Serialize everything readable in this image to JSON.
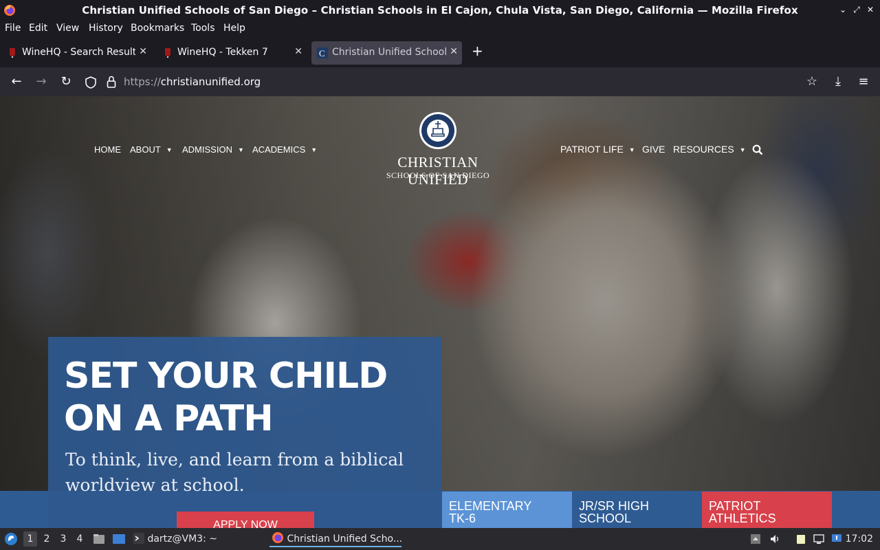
{
  "window": {
    "title": "Christian Unified Schools of San Diego – Christian Schools in El Cajon, Chula Vista, San Diego, California — Mozilla Firefox",
    "controls": [
      "⌄",
      "⤢",
      "✕"
    ]
  },
  "menubar": {
    "items": [
      "File",
      "Edit",
      "View",
      "History",
      "Bookmarks",
      "Tools",
      "Help"
    ]
  },
  "tabs": [
    {
      "label": "WineHQ - Search Results",
      "icon": "winehq-icon",
      "active": false
    },
    {
      "label": "WineHQ - Tekken 7",
      "icon": "winehq-icon",
      "active": false
    },
    {
      "label": "Christian Unified Schools",
      "icon": "cus-favicon",
      "active": true
    }
  ],
  "newtab_label": "+",
  "nav": {
    "url_prefix": "https://",
    "url_host": "christianunified.org"
  },
  "site": {
    "nav_left": [
      {
        "label": "HOME",
        "caret": false
      },
      {
        "label": "ABOUT",
        "caret": true
      },
      {
        "label": "ADMISSION",
        "caret": true
      },
      {
        "label": "ACADEMICS",
        "caret": true
      }
    ],
    "nav_right": [
      {
        "label": "PATRIOT LIFE",
        "caret": true
      },
      {
        "label": "GIVE",
        "caret": false
      },
      {
        "label": "RESOURCES",
        "caret": true
      }
    ],
    "logo_line1": "CHRISTIAN UNIFIED",
    "logo_line2": "SCHOOLS OF SAN DIEGO",
    "headline_line1": "SET YOUR CHILD",
    "headline_line2": "ON A PATH",
    "subheadline": "To think, live, and learn from a biblical worldview at school.",
    "apply_label": "APPLY NOW",
    "cards": [
      {
        "line1": "ELEMENTARY",
        "line2": "TK-6",
        "color": "#5b93d6"
      },
      {
        "line1": "JR/SR HIGH",
        "line2": "SCHOOL",
        "color": "#2f5b93"
      },
      {
        "line1": "PATRIOT",
        "line2": "ATHLETICS",
        "color": "#d8414b"
      }
    ]
  },
  "taskbar": {
    "workspaces": [
      "1",
      "2",
      "3",
      "4"
    ],
    "current_workspace": "1",
    "tasks": [
      {
        "label": "dartz@VM3: ~",
        "icon": "terminal-icon"
      },
      {
        "label": "Christian Unified Scho...",
        "icon": "firefox-icon"
      }
    ],
    "clock": "17:02"
  },
  "colors": {
    "chrome_bg": "#1c1b22",
    "toolbar_bg": "#2b2a33",
    "panel_blue": "#2e588e",
    "apply_red": "#d8414b"
  }
}
